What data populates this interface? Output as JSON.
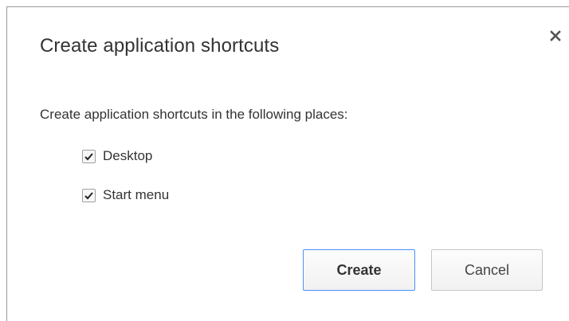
{
  "dialog": {
    "title": "Create application shortcuts",
    "prompt": "Create application shortcuts in the following places:",
    "close_icon": "close-icon"
  },
  "options": [
    {
      "label": "Desktop",
      "checked": true,
      "icon": "checkmark-icon"
    },
    {
      "label": "Start menu",
      "checked": true,
      "icon": "checkmark-icon"
    }
  ],
  "buttons": {
    "create_label": "Create",
    "cancel_label": "Cancel"
  },
  "colors": {
    "accent": "#4d90fe",
    "text": "#333333",
    "border": "#c6c6c6"
  }
}
